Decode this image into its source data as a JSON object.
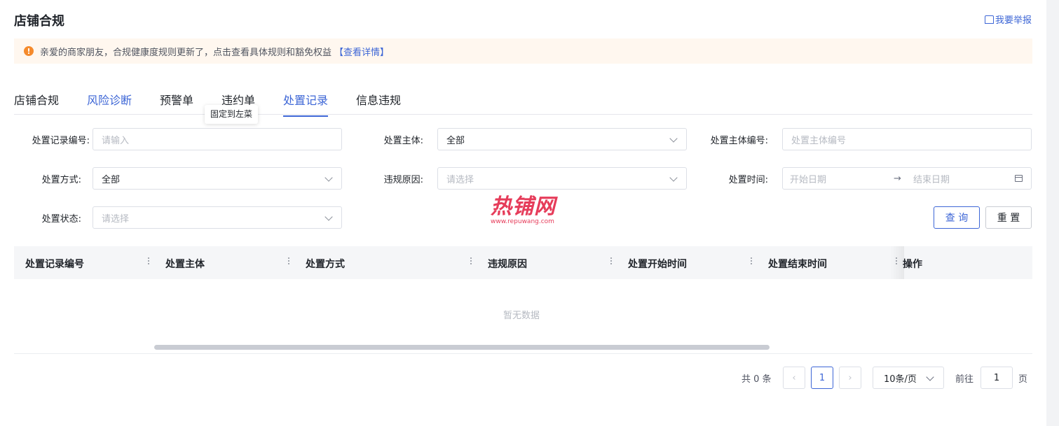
{
  "header": {
    "title": "店铺合规",
    "report_link": "我要举报"
  },
  "notice": {
    "text": "亲爱的商家朋友，合规健康度规则更新了，点击查看具体规则和豁免权益",
    "link": "【查看详情】"
  },
  "tabs": [
    {
      "label": "店铺合规",
      "state": "normal"
    },
    {
      "label": "风险诊断",
      "state": "highlight"
    },
    {
      "label": "预警单",
      "state": "normal"
    },
    {
      "label": "违约单",
      "state": "normal"
    },
    {
      "label": "处置记录",
      "state": "active"
    },
    {
      "label": "信息违规",
      "state": "normal"
    }
  ],
  "tooltip": "固定到左菜",
  "filters": {
    "record_no": {
      "label": "处置记录编号:",
      "placeholder": "请输入"
    },
    "subject": {
      "label": "处置主体:",
      "value": "全部"
    },
    "subject_no": {
      "label": "处置主体编号:",
      "placeholder": "处置主体编号"
    },
    "method": {
      "label": "处置方式:",
      "value": "全部"
    },
    "reason": {
      "label": "违规原因:",
      "placeholder": "请选择"
    },
    "time": {
      "label": "处置时间:",
      "start_placeholder": "开始日期",
      "arrow": "→",
      "end_placeholder": "结束日期"
    },
    "status": {
      "label": "处置状态:",
      "placeholder": "请选择"
    }
  },
  "buttons": {
    "query": "查 询",
    "reset": "重 置"
  },
  "watermark": {
    "brand": "热铺网",
    "url": "www.repuwang.com"
  },
  "table": {
    "columns": [
      "处置记录编号",
      "处置主体",
      "处置方式",
      "违规原因",
      "处置开始时间",
      "处置结束时间",
      "操作"
    ],
    "empty_text": "暂无数据"
  },
  "pagination": {
    "total_text": "共 0 条",
    "prev": "‹",
    "current_page": "1",
    "next": "›",
    "page_size": "10条/页",
    "goto_label": "前往",
    "goto_value": "1",
    "goto_suffix": "页"
  },
  "colors": {
    "accent": "#3d66d6",
    "warning": "#f58a2c",
    "notice_bg": "#fff7ef",
    "watermark": "#e63c5a"
  }
}
